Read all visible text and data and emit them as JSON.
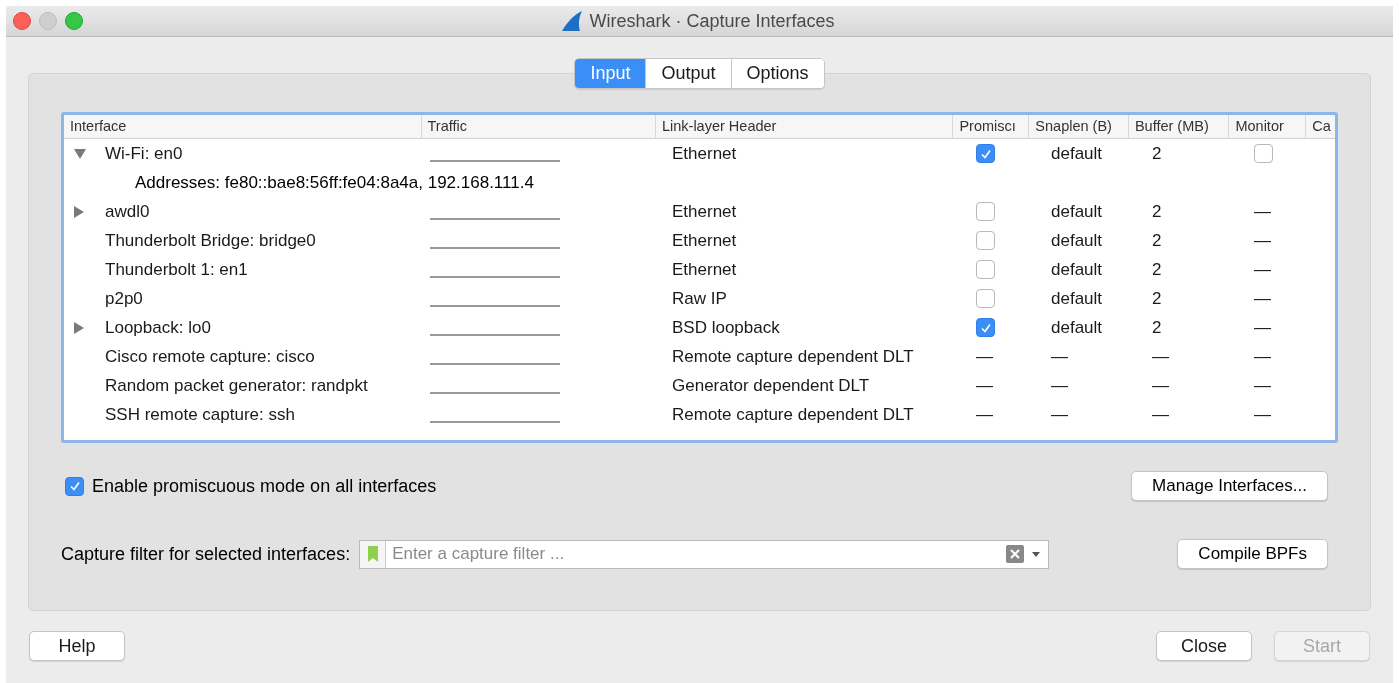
{
  "window": {
    "title": "Wireshark · Capture Interfaces"
  },
  "tabs": [
    {
      "label": "Input",
      "selected": true
    },
    {
      "label": "Output",
      "selected": false
    },
    {
      "label": "Options",
      "selected": false
    }
  ],
  "table": {
    "columns": [
      "Interface",
      "Traffic",
      "Link-layer Header",
      "Promiscı",
      "Snaplen (B)",
      "Buffer (MB)",
      "Monitor",
      "Ca"
    ],
    "rows": [
      {
        "interface": "Wi-Fi: en0",
        "expandable": true,
        "expanded": true,
        "link_layer": "Ethernet",
        "promiscuous": {
          "kind": "checkbox",
          "checked": true
        },
        "snaplen": "default",
        "buffer": "2",
        "monitor": {
          "kind": "checkbox",
          "checked": false
        },
        "children": [
          {
            "text": "Addresses: fe80::bae8:56ff:fe04:8a4a, 192.168.111.4"
          }
        ]
      },
      {
        "interface": "awdl0",
        "expandable": true,
        "expanded": false,
        "link_layer": "Ethernet",
        "promiscuous": {
          "kind": "checkbox",
          "checked": false
        },
        "snaplen": "default",
        "buffer": "2",
        "monitor": {
          "kind": "text",
          "text": "—"
        }
      },
      {
        "interface": "Thunderbolt Bridge: bridge0",
        "expandable": false,
        "link_layer": "Ethernet",
        "promiscuous": {
          "kind": "checkbox",
          "checked": false
        },
        "snaplen": "default",
        "buffer": "2",
        "monitor": {
          "kind": "text",
          "text": "—"
        }
      },
      {
        "interface": "Thunderbolt 1: en1",
        "expandable": false,
        "link_layer": "Ethernet",
        "promiscuous": {
          "kind": "checkbox",
          "checked": false
        },
        "snaplen": "default",
        "buffer": "2",
        "monitor": {
          "kind": "text",
          "text": "—"
        }
      },
      {
        "interface": "p2p0",
        "expandable": false,
        "link_layer": "Raw IP",
        "promiscuous": {
          "kind": "checkbox",
          "checked": false
        },
        "snaplen": "default",
        "buffer": "2",
        "monitor": {
          "kind": "text",
          "text": "—"
        }
      },
      {
        "interface": "Loopback: lo0",
        "expandable": true,
        "expanded": false,
        "link_layer": "BSD loopback",
        "promiscuous": {
          "kind": "checkbox",
          "checked": true
        },
        "snaplen": "default",
        "buffer": "2",
        "monitor": {
          "kind": "text",
          "text": "—"
        }
      },
      {
        "interface": "Cisco remote capture: cisco",
        "expandable": false,
        "link_layer": "Remote capture dependent DLT",
        "promiscuous": {
          "kind": "text",
          "text": "—"
        },
        "snaplen": "—",
        "buffer": "—",
        "monitor": {
          "kind": "text",
          "text": "—"
        }
      },
      {
        "interface": "Random packet generator: randpkt",
        "expandable": false,
        "link_layer": "Generator dependent DLT",
        "promiscuous": {
          "kind": "text",
          "text": "—"
        },
        "snaplen": "—",
        "buffer": "—",
        "monitor": {
          "kind": "text",
          "text": "—"
        }
      },
      {
        "interface": "SSH remote capture: ssh",
        "expandable": false,
        "link_layer": "Remote capture dependent DLT",
        "promiscuous": {
          "kind": "text",
          "text": "—"
        },
        "snaplen": "—",
        "buffer": "—",
        "monitor": {
          "kind": "text",
          "text": "—"
        }
      }
    ]
  },
  "promiscuous_all": {
    "label": "Enable promiscuous mode on all interfaces",
    "checked": true
  },
  "manage_button": "Manage Interfaces...",
  "capture_filter": {
    "label": "Capture filter for selected interfaces:",
    "placeholder": "Enter a capture filter ..."
  },
  "compile_button": "Compile BPFs",
  "buttons": [
    {
      "label": "Help",
      "disabled": false
    },
    {
      "label": "Close",
      "disabled": false
    },
    {
      "label": "Start",
      "disabled": true
    }
  ]
}
